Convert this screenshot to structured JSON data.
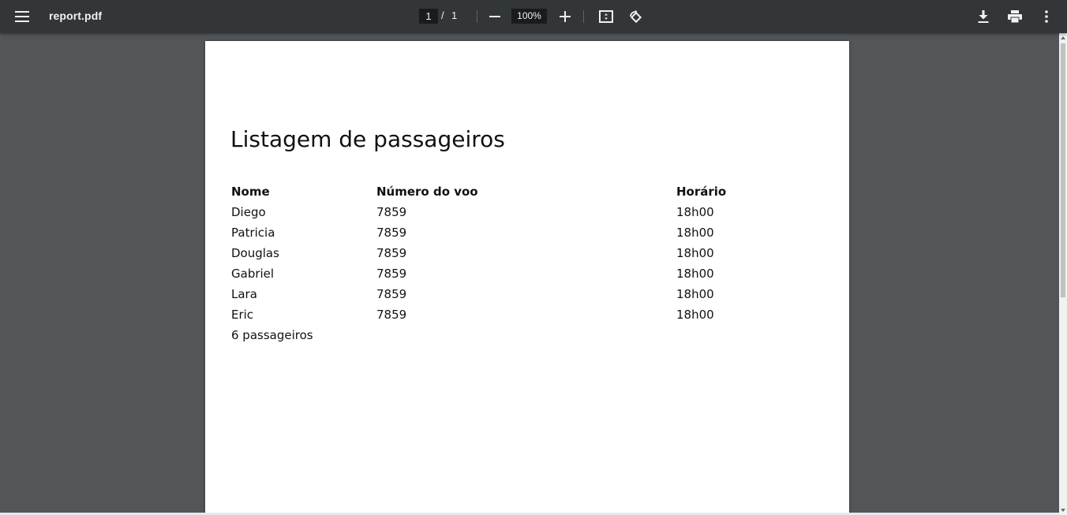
{
  "toolbar": {
    "menu_icon": "hamburger-menu-icon",
    "title": "report.pdf",
    "page_current": "1",
    "page_separator": "/",
    "page_total": "1",
    "zoom": "100%",
    "icons": {
      "zoom_out": "minus-icon",
      "zoom_in": "plus-icon",
      "fit": "fit-to-page-icon",
      "rotate": "rotate-icon",
      "download": "download-icon",
      "print": "print-icon",
      "more": "more-vertical-icon"
    }
  },
  "document": {
    "title": "Listagem de passageiros",
    "headers": [
      "Nome",
      "Número do voo",
      "Horário"
    ],
    "rows": [
      [
        "Diego",
        "7859",
        "18h00"
      ],
      [
        "Patricia",
        "7859",
        "18h00"
      ],
      [
        "Douglas",
        "7859",
        "18h00"
      ],
      [
        "Gabriel",
        "7859",
        "18h00"
      ],
      [
        "Lara",
        "7859",
        "18h00"
      ],
      [
        "Eric",
        "7859",
        "18h00"
      ]
    ],
    "summary": "6 passageiros"
  },
  "colors": {
    "toolbar_bg": "#323639",
    "viewer_bg": "#525659",
    "page_bg": "#ffffff",
    "text": "#111111"
  }
}
